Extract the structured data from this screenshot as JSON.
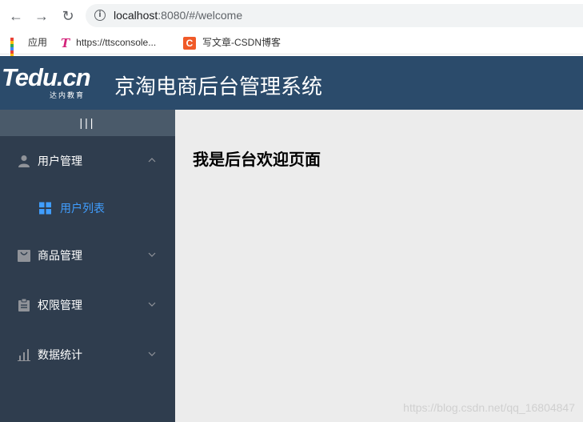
{
  "browser": {
    "url_host": "localhost",
    "url_rest": ":8080/#/welcome",
    "bookmarks": [
      {
        "label": "应用",
        "icon": "apps-grid-icon"
      },
      {
        "label": "https://ttsconsole...",
        "icon": "tts-logo-icon"
      },
      {
        "label": "写文章-CSDN博客",
        "icon": "csdn-icon"
      }
    ],
    "icon_glyphs": {
      "back": "←",
      "forward": "→",
      "reload": "↻",
      "info": "i",
      "csdn": "C",
      "tts": "T"
    }
  },
  "header": {
    "logo_text": "Tedu.cn",
    "logo_sub": "达内教育",
    "title": "京淘电商后台管理系统",
    "color": "#2b4b6b"
  },
  "sidebar": {
    "toggle_label": "|||",
    "menus": [
      {
        "label": "用户管理",
        "icon": "user-icon",
        "expanded": true
      },
      {
        "label": "商品管理",
        "icon": "shopping-bag-icon",
        "expanded": false
      },
      {
        "label": "权限管理",
        "icon": "clipboard-icon",
        "expanded": false
      },
      {
        "label": "数据统计",
        "icon": "bar-chart-icon",
        "expanded": false
      }
    ],
    "submenu": {
      "label": "用户列表",
      "icon": "grid-icon",
      "active_color": "#409eff"
    }
  },
  "main": {
    "welcome_text": "我是后台欢迎页面",
    "watermark": "https://blog.csdn.net/qq_16804847"
  }
}
